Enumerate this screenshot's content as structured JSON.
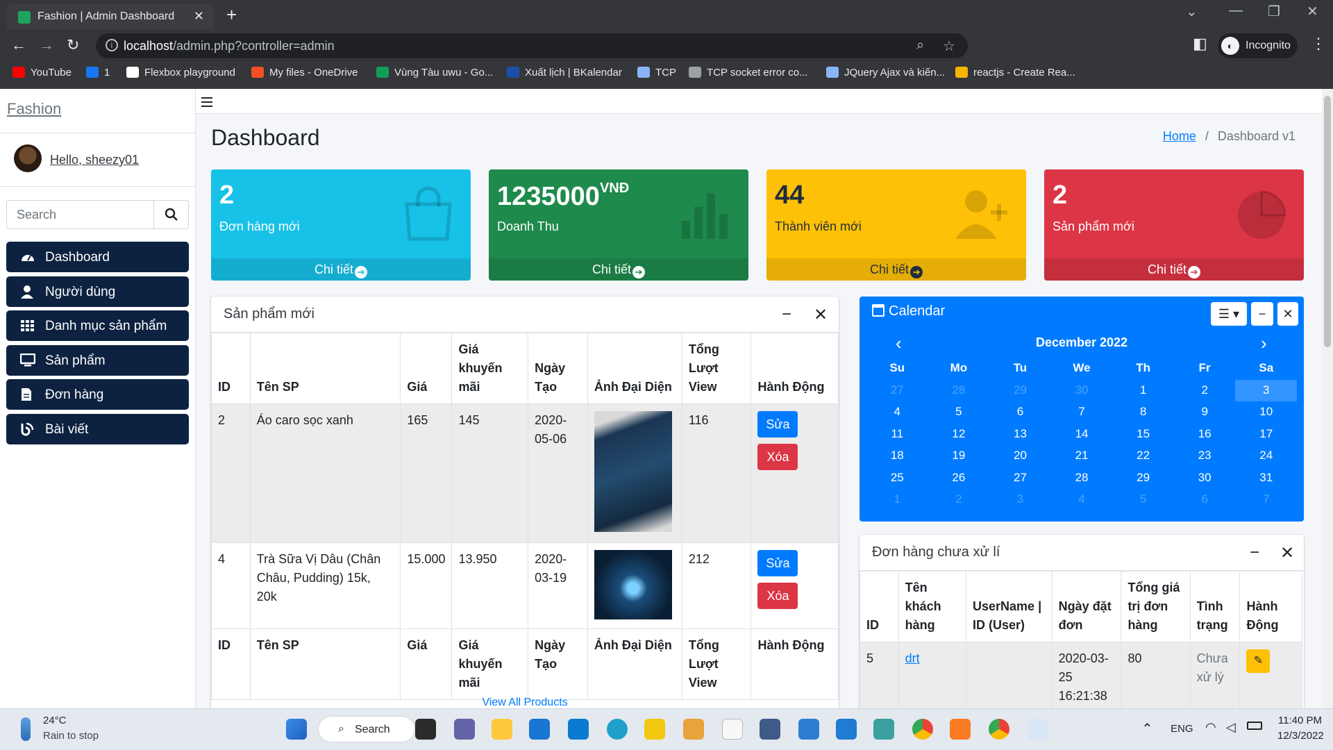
{
  "browser": {
    "tab_title": "Fashion | Admin Dashboard",
    "url_host": "localhost",
    "url_path": "/admin.php?controller=admin",
    "profile_label": "Incognito",
    "bookmarks": [
      {
        "label": "YouTube",
        "color": "#ff0000"
      },
      {
        "label": "1",
        "color": "#1877f2"
      },
      {
        "label": "Flexbox playground",
        "color": "#ffffff"
      },
      {
        "label": "My files - OneDrive",
        "color": "#f25022"
      },
      {
        "label": "Vùng Tàu uwu - Go...",
        "color": "#0f9d58"
      },
      {
        "label": "Xuất lịch | BKalendar",
        "color": "#1e4fa8"
      },
      {
        "label": "TCP",
        "color": "#8ab4f8"
      },
      {
        "label": "TCP socket error co...",
        "color": "#9aa0a6"
      },
      {
        "label": "JQuery Ajax và kiến...",
        "color": "#8ab4f8"
      },
      {
        "label": "reactjs - Create Rea...",
        "color": "#f4b400"
      }
    ]
  },
  "sidebar": {
    "brand": "Fashion",
    "user_greeting": "Hello, sheezy01",
    "search_placeholder": "Search",
    "items": [
      {
        "label": "Dashboard",
        "icon": "gauge-icon"
      },
      {
        "label": "Người dùng",
        "icon": "user-icon"
      },
      {
        "label": "Danh mục sản phẩm",
        "icon": "grid-icon"
      },
      {
        "label": "Sản phẩm",
        "icon": "monitor-icon"
      },
      {
        "label": "Đơn hàng",
        "icon": "file-icon"
      },
      {
        "label": "Bài viết",
        "icon": "blog-icon"
      }
    ]
  },
  "page": {
    "title": "Dashboard",
    "breadcrumb_home": "Home",
    "breadcrumb_sep": "/",
    "breadcrumb_current": "Dashboard v1"
  },
  "stats": [
    {
      "value": "2",
      "unit": "",
      "label": "Đơn hàng mới",
      "link": "Chi tiết",
      "color": "#17c1e8"
    },
    {
      "value": "1235000",
      "unit": "VNĐ",
      "label": "Doanh Thu",
      "link": "Chi tiết",
      "color": "#1e8a4c"
    },
    {
      "value": "44",
      "unit": "",
      "label": "Thành viên mới",
      "link": "Chi tiết",
      "color": "#ffc107"
    },
    {
      "value": "2",
      "unit": "",
      "label": "Sản phẩm mới",
      "link": "Chi tiết",
      "color": "#dc3545"
    }
  ],
  "products": {
    "title": "Sản phẩm mới",
    "headers": [
      "ID",
      "Tên SP",
      "Giá",
      "Giá khuyến mãi",
      "Ngày Tạo",
      "Ảnh Đại Diện",
      "Tổng Lượt View",
      "Hành Động"
    ],
    "edit_label": "Sửa",
    "delete_label": "Xóa",
    "rows": [
      {
        "id": "2",
        "name": "Áo caro sọc xanh",
        "price": "165",
        "sale": "145",
        "date": "2020-05-06",
        "views": "116"
      },
      {
        "id": "4",
        "name": "Trà Sữa Vị Dâu (Chân Châu, Pudding) 15k, 20k",
        "price": "15.000",
        "sale": "13.950",
        "date": "2020-03-19",
        "views": "212"
      }
    ],
    "view_all": "View All Products"
  },
  "calendar": {
    "title": "Calendar",
    "month": "December 2022",
    "weekdays": [
      "Su",
      "Mo",
      "Tu",
      "We",
      "Th",
      "Fr",
      "Sa"
    ],
    "weeks": [
      [
        "27",
        "28",
        "29",
        "30",
        "1",
        "2",
        "3"
      ],
      [
        "4",
        "5",
        "6",
        "7",
        "8",
        "9",
        "10"
      ],
      [
        "11",
        "12",
        "13",
        "14",
        "15",
        "16",
        "17"
      ],
      [
        "18",
        "19",
        "20",
        "21",
        "22",
        "23",
        "24"
      ],
      [
        "25",
        "26",
        "27",
        "28",
        "29",
        "30",
        "31"
      ],
      [
        "1",
        "2",
        "3",
        "4",
        "5",
        "6",
        "7"
      ]
    ],
    "selected": "3"
  },
  "orders": {
    "title": "Đơn hàng chưa xử lí",
    "headers": [
      "ID",
      "Tên khách hàng",
      "UserName | ID (User)",
      "Ngày đặt đơn",
      "Tổng giá trị đơn hàng",
      "Tình trạng",
      "Hành Động"
    ],
    "rows": [
      {
        "id": "5",
        "customer": "drt",
        "user": "",
        "date": "2020-03-25 16:21:38",
        "total": "80",
        "status": "Chưa xử lý"
      }
    ]
  },
  "taskbar": {
    "weather_temp": "24°C",
    "weather_desc": "Rain to stop",
    "search_label": "Search",
    "lang": "ENG",
    "time": "11:40 PM",
    "date": "12/3/2022"
  }
}
